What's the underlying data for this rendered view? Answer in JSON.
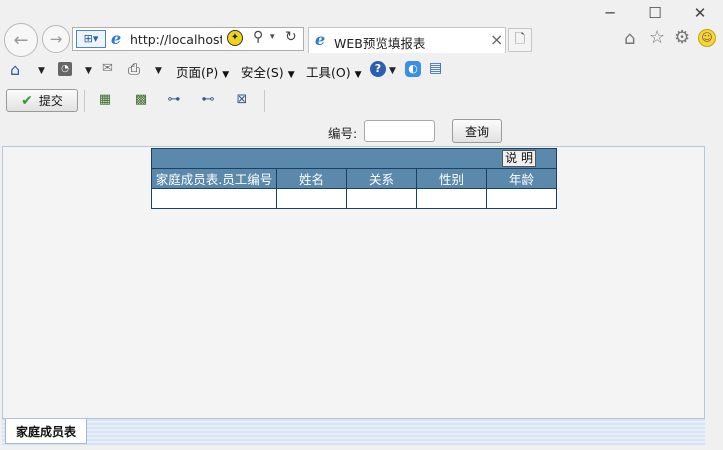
{
  "window": {
    "minimize": "─",
    "maximize": "☐",
    "close": "✕"
  },
  "browser": {
    "address": "http://localhost:",
    "tab_title": "WEB预览填报表",
    "tab_close": "×"
  },
  "menubar": {
    "page": "页面(P)",
    "safety": "安全(S)",
    "tools": "工具(O)"
  },
  "report_toolbar": {
    "submit_label": "提交"
  },
  "query": {
    "label": "编号:",
    "input_value": "",
    "button_label": "查询"
  },
  "table": {
    "explain_button": "说 明",
    "columns": [
      "家庭成员表.员工编号",
      "姓名",
      "关系",
      "性别",
      "年龄"
    ],
    "rows": [
      [
        "",
        "",
        "",
        "",
        ""
      ]
    ]
  },
  "sheets": {
    "active": "家庭成员表"
  },
  "colors": {
    "header_bg": "#5b89ac",
    "border": "#1f3f62"
  }
}
